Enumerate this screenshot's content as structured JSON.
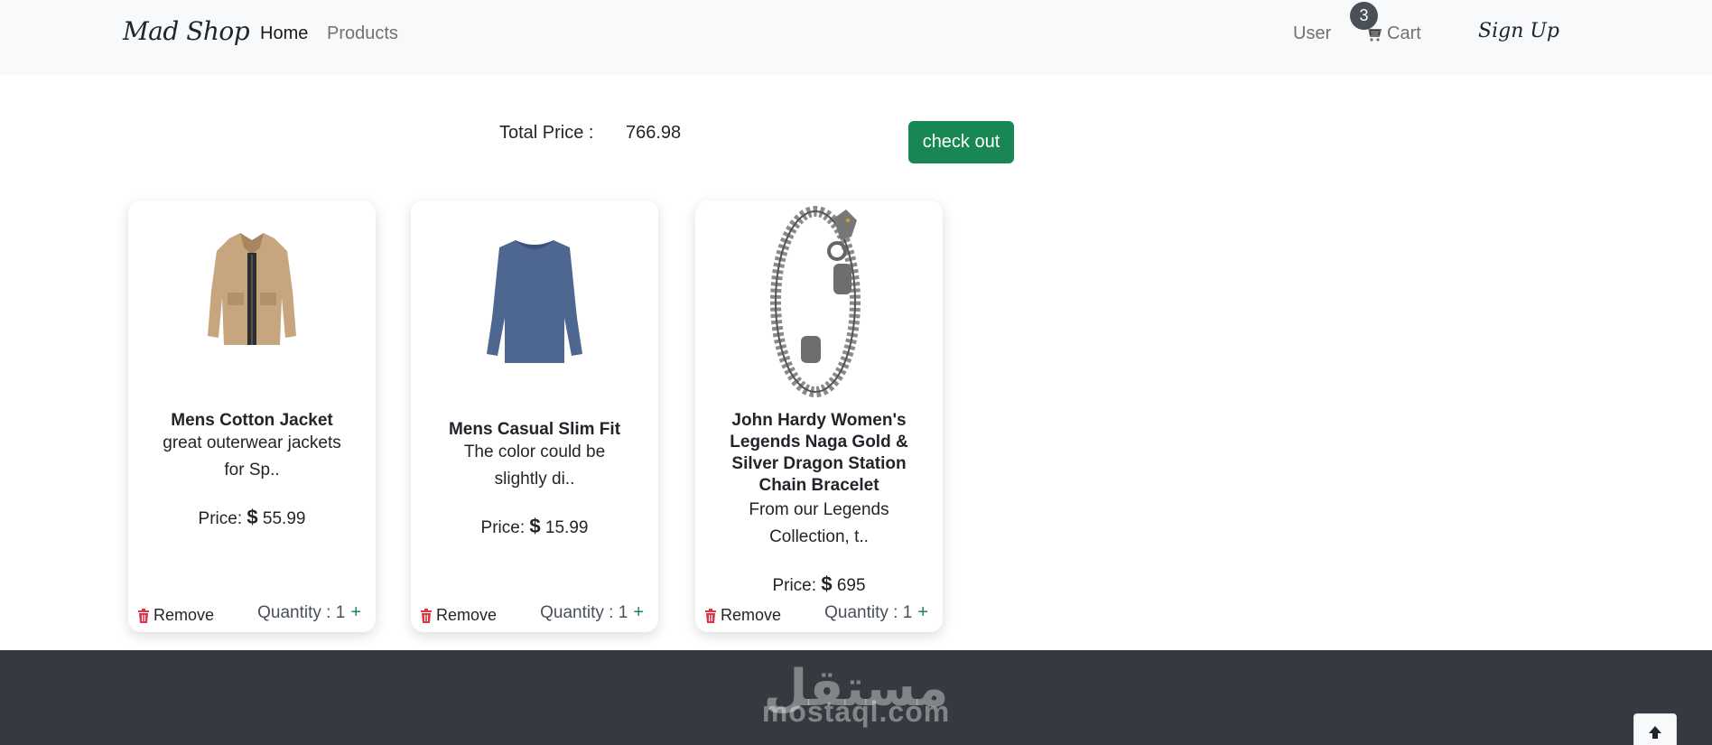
{
  "nav": {
    "brand": "Mad Shop",
    "links": [
      {
        "label": "Home",
        "active": true
      },
      {
        "label": "Products",
        "active": false
      }
    ],
    "user": "User",
    "cart_label": "Cart",
    "cart_count": "3",
    "signup": "Sign Up"
  },
  "summary": {
    "total_label": "Total Price :",
    "total_value": "766.98",
    "checkout_label": "check out"
  },
  "cards": [
    {
      "title": "Mens Cotton Jacket",
      "description": "great outerwear jackets for Sp..",
      "price_label": "Price:",
      "currency": "$",
      "price": "55.99",
      "remove_label": "Remove",
      "quantity_label": "Quantity : 1",
      "plus": "+"
    },
    {
      "title": "Mens Casual Slim Fit",
      "description": "The color could be slightly di..",
      "price_label": "Price:",
      "currency": "$",
      "price": "15.99",
      "remove_label": "Remove",
      "quantity_label": "Quantity : 1",
      "plus": "+"
    },
    {
      "title": "John Hardy Women's Legends Naga Gold & Silver Dragon Station Chain Bracelet",
      "description": "From our Legends Collection, t..",
      "price_label": "Price:",
      "currency": "$",
      "price": "695",
      "remove_label": "Remove",
      "quantity_label": "Quantity : 1",
      "plus": "+"
    }
  ],
  "footer": {
    "watermark_ar": "مستقل",
    "watermark_en": "mostaql.com"
  },
  "icons": {
    "cart": "cart-icon",
    "trash": "trash-icon",
    "up": "arrow-up-icon"
  },
  "colors": {
    "success": "#198754",
    "danger": "#dc3545",
    "footer": "#343a40",
    "navbar": "#f8f9fa"
  }
}
